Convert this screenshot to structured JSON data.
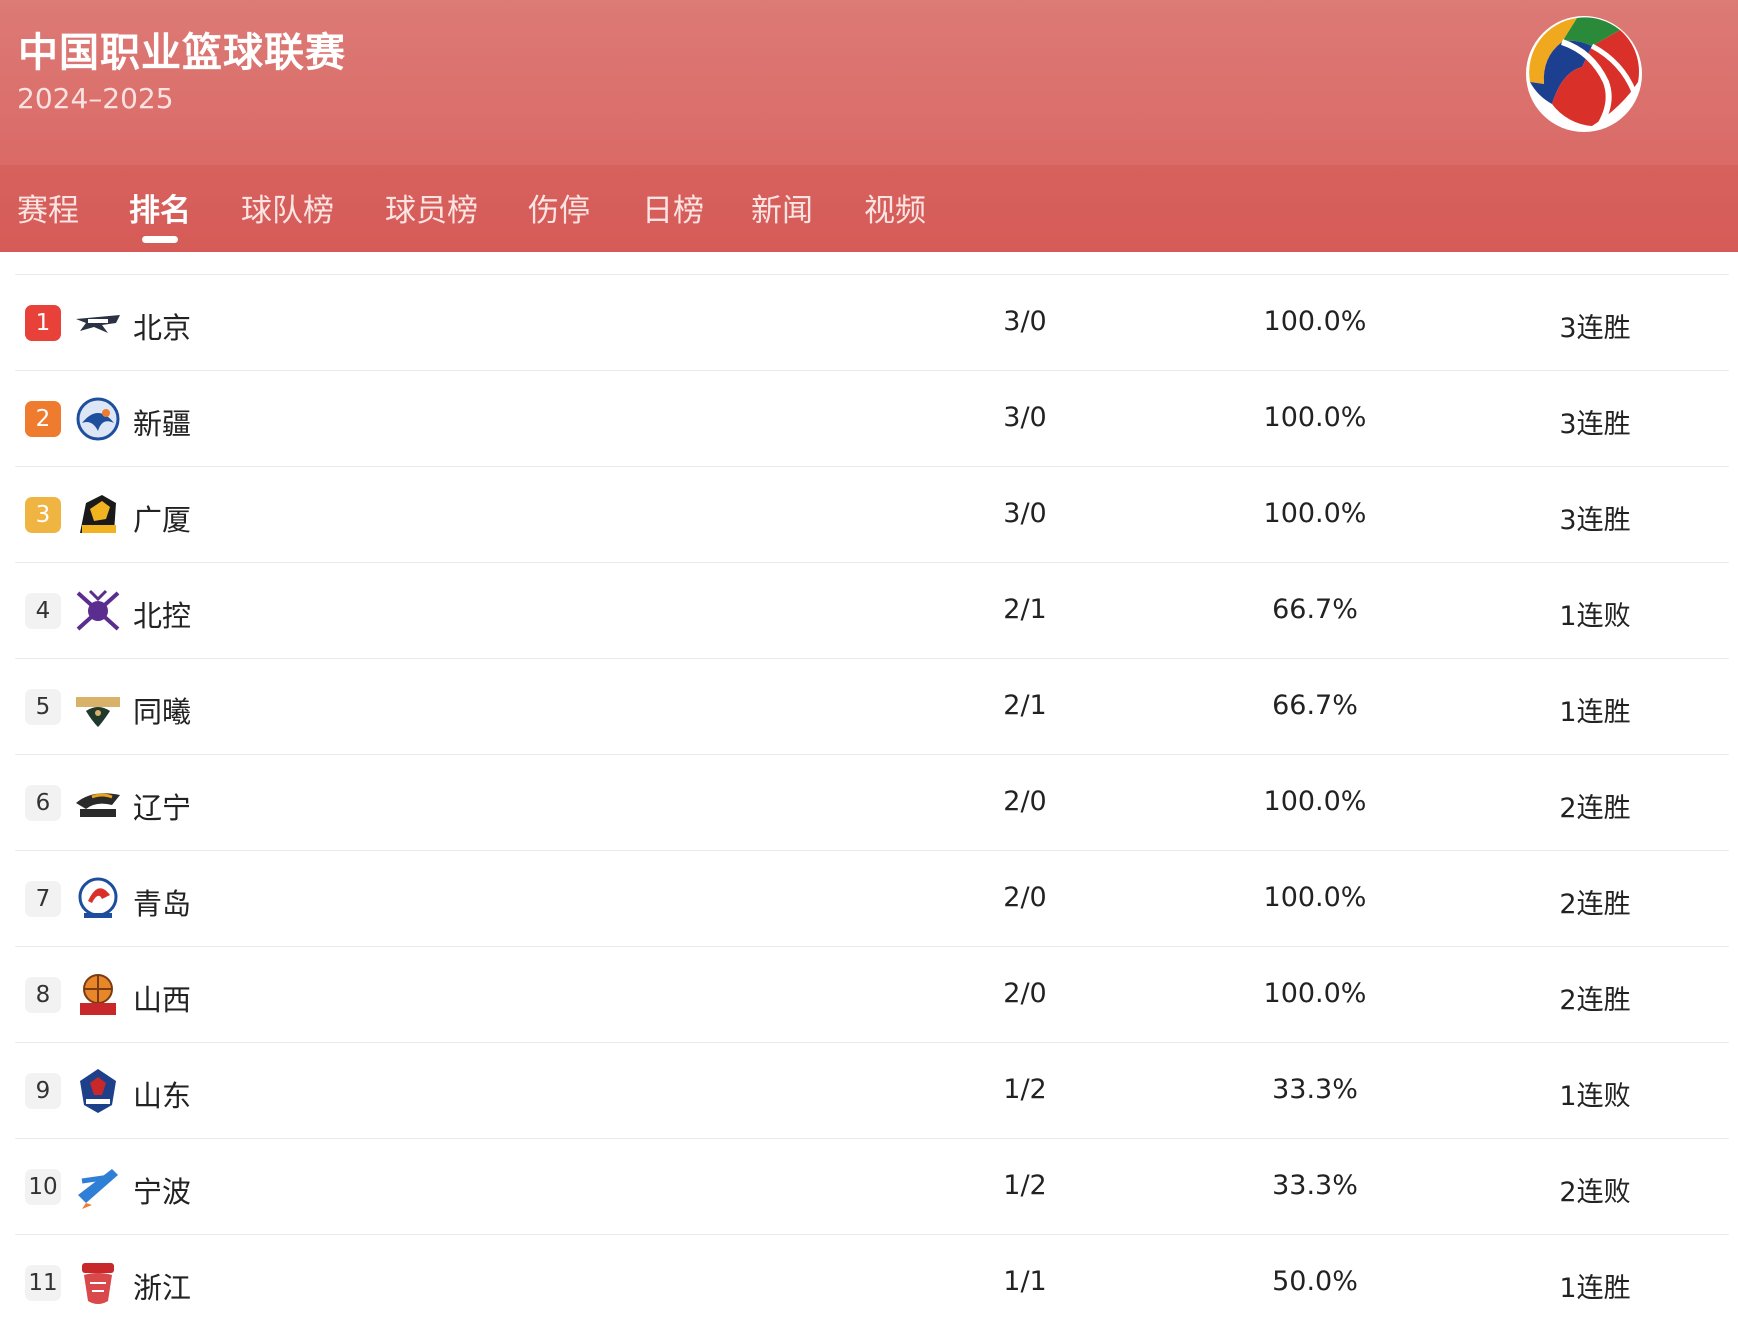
{
  "header": {
    "title": "中国职业篮球联赛",
    "season": "2024–2025",
    "logo_icon": "cba-logo-icon"
  },
  "tabs": [
    {
      "label": "赛程",
      "active": false
    },
    {
      "label": "排名",
      "active": true
    },
    {
      "label": "球队榜",
      "active": false
    },
    {
      "label": "球员榜",
      "active": false
    },
    {
      "label": "伤停",
      "active": false
    },
    {
      "label": "日榜",
      "active": false
    },
    {
      "label": "新闻",
      "active": false
    },
    {
      "label": "视频",
      "active": false
    }
  ],
  "colors": {
    "header_top": "#dc7a76",
    "header_bottom": "#d9625e",
    "rank1": "#e8413a",
    "rank2": "#ef7b2f",
    "rank3": "#f0b443"
  },
  "standings": [
    {
      "rank": "1",
      "team": "北京",
      "record": "3/0",
      "pct": "100.0%",
      "streak": "3连胜",
      "logo": "beijing-logo-icon"
    },
    {
      "rank": "2",
      "team": "新疆",
      "record": "3/0",
      "pct": "100.0%",
      "streak": "3连胜",
      "logo": "xinjiang-logo-icon"
    },
    {
      "rank": "3",
      "team": "广厦",
      "record": "3/0",
      "pct": "100.0%",
      "streak": "3连胜",
      "logo": "guangsha-logo-icon"
    },
    {
      "rank": "4",
      "team": "北控",
      "record": "2/1",
      "pct": "66.7%",
      "streak": "1连败",
      "logo": "beikong-logo-icon"
    },
    {
      "rank": "5",
      "team": "同曦",
      "record": "2/1",
      "pct": "66.7%",
      "streak": "1连胜",
      "logo": "tongxi-logo-icon"
    },
    {
      "rank": "6",
      "team": "辽宁",
      "record": "2/0",
      "pct": "100.0%",
      "streak": "2连胜",
      "logo": "liaoning-logo-icon"
    },
    {
      "rank": "7",
      "team": "青岛",
      "record": "2/0",
      "pct": "100.0%",
      "streak": "2连胜",
      "logo": "qingdao-logo-icon"
    },
    {
      "rank": "8",
      "team": "山西",
      "record": "2/0",
      "pct": "100.0%",
      "streak": "2连胜",
      "logo": "shanxi-logo-icon"
    },
    {
      "rank": "9",
      "team": "山东",
      "record": "1/2",
      "pct": "33.3%",
      "streak": "1连败",
      "logo": "shandong-logo-icon"
    },
    {
      "rank": "10",
      "team": "宁波",
      "record": "1/2",
      "pct": "33.3%",
      "streak": "2连败",
      "logo": "ningbo-logo-icon"
    },
    {
      "rank": "11",
      "team": "浙江",
      "record": "1/1",
      "pct": "50.0%",
      "streak": "1连胜",
      "logo": "zhejiang-logo-icon"
    }
  ]
}
